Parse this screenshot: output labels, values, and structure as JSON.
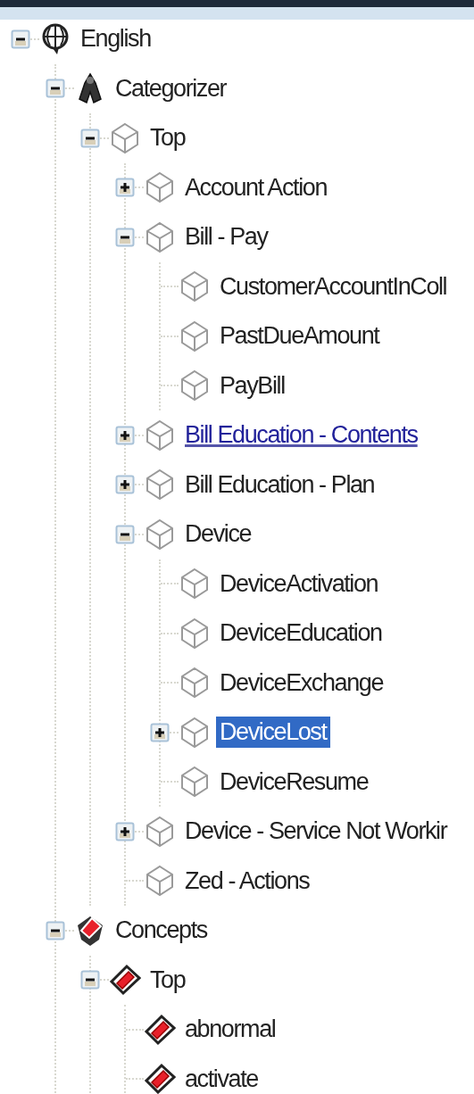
{
  "tree": [
    {
      "label": "English",
      "kind": "language",
      "expanded": true,
      "selected": false,
      "link": false,
      "children": [
        {
          "label": "Categorizer",
          "kind": "categorizer",
          "expanded": true,
          "selected": false,
          "link": false,
          "children": [
            {
              "label": "Top",
              "kind": "category",
              "expanded": true,
              "selected": false,
              "link": false,
              "children": [
                {
                  "label": "Account Action",
                  "kind": "category",
                  "expanded": false,
                  "selected": false,
                  "link": false
                },
                {
                  "label": "Bill - Pay",
                  "kind": "category",
                  "expanded": true,
                  "selected": false,
                  "link": false,
                  "children": [
                    {
                      "label": "CustomerAccountInColl",
                      "kind": "category",
                      "selected": false,
                      "link": false
                    },
                    {
                      "label": "PastDueAmount",
                      "kind": "category",
                      "selected": false,
                      "link": false
                    },
                    {
                      "label": "PayBill",
                      "kind": "category",
                      "selected": false,
                      "link": false
                    }
                  ]
                },
                {
                  "label": "Bill Education - Contents",
                  "kind": "category",
                  "expanded": false,
                  "selected": false,
                  "link": true
                },
                {
                  "label": "Bill Education - Plan",
                  "kind": "category",
                  "expanded": false,
                  "selected": false,
                  "link": false
                },
                {
                  "label": "Device",
                  "kind": "category",
                  "expanded": true,
                  "selected": false,
                  "link": false,
                  "children": [
                    {
                      "label": "DeviceActivation",
                      "kind": "category",
                      "selected": false,
                      "link": false
                    },
                    {
                      "label": "DeviceEducation",
                      "kind": "category",
                      "selected": false,
                      "link": false
                    },
                    {
                      "label": "DeviceExchange",
                      "kind": "category",
                      "selected": false,
                      "link": false
                    },
                    {
                      "label": "DeviceLost",
                      "kind": "category",
                      "expanded": false,
                      "selected": true,
                      "link": false
                    },
                    {
                      "label": "DeviceResume",
                      "kind": "category",
                      "selected": false,
                      "link": false
                    }
                  ]
                },
                {
                  "label": "Device - Service Not Workir",
                  "kind": "category",
                  "expanded": false,
                  "selected": false,
                  "link": false
                },
                {
                  "label": "Zed - Actions",
                  "kind": "category",
                  "selected": false,
                  "link": false
                }
              ]
            }
          ]
        },
        {
          "label": "Concepts",
          "kind": "concepts",
          "expanded": true,
          "selected": false,
          "link": false,
          "children": [
            {
              "label": "Top",
              "kind": "concept",
              "expanded": true,
              "selected": false,
              "link": false,
              "children": [
                {
                  "label": "abnormal",
                  "kind": "concept",
                  "selected": false,
                  "link": false
                },
                {
                  "label": "activate",
                  "kind": "concept",
                  "selected": false,
                  "link": false
                }
              ]
            }
          ]
        }
      ]
    }
  ]
}
